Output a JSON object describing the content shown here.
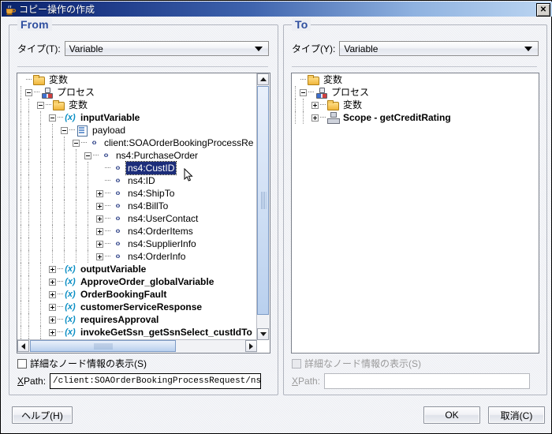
{
  "window": {
    "title": "コピー操作の作成",
    "icon": "java-coffee-cup-icon",
    "close_label": "✕"
  },
  "from_panel": {
    "title": "From",
    "type_label": "タイプ(T):",
    "type_value": "Variable",
    "type_icon": "chevron-down-icon",
    "checkbox_label": "詳細なノード情報の表示(S)",
    "checkbox_checked": false,
    "xpath_label": "XPath:",
    "xpath_value": "/client:SOAOrderBookingProcessRequest/ns",
    "tree": [
      {
        "depth": 0,
        "expander": "none",
        "icon": "folder-icon",
        "label": "変数",
        "bold": false,
        "selected": false
      },
      {
        "depth": 1,
        "expander": "minus",
        "icon": "process-icon",
        "label": "プロセス",
        "bold": false,
        "selected": false
      },
      {
        "depth": 2,
        "expander": "minus",
        "icon": "folder-icon",
        "label": "変数",
        "bold": false,
        "selected": false
      },
      {
        "depth": 3,
        "expander": "minus",
        "icon": "variable-icon",
        "label": "inputVariable",
        "bold": true,
        "selected": false
      },
      {
        "depth": 4,
        "expander": "minus",
        "icon": "payload-icon",
        "label": "payload",
        "bold": false,
        "selected": false
      },
      {
        "depth": 5,
        "expander": "minus",
        "icon": "element-icon",
        "label": "client:SOAOrderBookingProcessRe",
        "bold": false,
        "selected": false
      },
      {
        "depth": 6,
        "expander": "minus",
        "icon": "element-icon",
        "label": "ns4:PurchaseOrder",
        "bold": false,
        "selected": false
      },
      {
        "depth": 7,
        "expander": "none",
        "icon": "element-icon",
        "label": "ns4:CustID",
        "bold": false,
        "selected": true
      },
      {
        "depth": 7,
        "expander": "none",
        "icon": "element-icon",
        "label": "ns4:ID",
        "bold": false,
        "selected": false
      },
      {
        "depth": 7,
        "expander": "plus",
        "icon": "element-icon",
        "label": "ns4:ShipTo",
        "bold": false,
        "selected": false
      },
      {
        "depth": 7,
        "expander": "plus",
        "icon": "element-icon",
        "label": "ns4:BillTo",
        "bold": false,
        "selected": false
      },
      {
        "depth": 7,
        "expander": "plus",
        "icon": "element-icon",
        "label": "ns4:UserContact",
        "bold": false,
        "selected": false
      },
      {
        "depth": 7,
        "expander": "plus",
        "icon": "element-icon",
        "label": "ns4:OrderItems",
        "bold": false,
        "selected": false
      },
      {
        "depth": 7,
        "expander": "plus",
        "icon": "element-icon",
        "label": "ns4:SupplierInfo",
        "bold": false,
        "selected": false
      },
      {
        "depth": 7,
        "expander": "plus",
        "icon": "element-icon",
        "label": "ns4:OrderInfo",
        "bold": false,
        "selected": false
      },
      {
        "depth": 3,
        "expander": "plus",
        "icon": "variable-icon",
        "label": "outputVariable",
        "bold": true,
        "selected": false
      },
      {
        "depth": 3,
        "expander": "plus",
        "icon": "variable-icon",
        "label": "ApproveOrder_globalVariable",
        "bold": true,
        "selected": false
      },
      {
        "depth": 3,
        "expander": "plus",
        "icon": "variable-icon",
        "label": "OrderBookingFault",
        "bold": true,
        "selected": false
      },
      {
        "depth": 3,
        "expander": "plus",
        "icon": "variable-icon",
        "label": "customerServiceResponse",
        "bold": true,
        "selected": false
      },
      {
        "depth": 3,
        "expander": "plus",
        "icon": "variable-icon",
        "label": "requiresApproval",
        "bold": true,
        "selected": false
      },
      {
        "depth": 3,
        "expander": "plus",
        "icon": "variable-icon",
        "label": "invokeGetSsn_getSsnSelect_custIdTo",
        "bold": true,
        "selected": false
      },
      {
        "depth": 3,
        "expander": "plus",
        "icon": "variable-icon",
        "label": "invokeGetSsn_getSsnSelect_custIdTo",
        "bold": true,
        "selected": false
      }
    ]
  },
  "to_panel": {
    "title": "To",
    "type_label": "タイプ(Y):",
    "type_value": "Variable",
    "type_icon": "chevron-down-icon",
    "checkbox_label": "詳細なノード情報の表示(S)",
    "checkbox_checked": false,
    "checkbox_disabled": true,
    "xpath_label": "XPath:",
    "xpath_value": "",
    "xpath_disabled": true,
    "tree": [
      {
        "depth": 0,
        "expander": "none",
        "icon": "folder-icon",
        "label": "変数",
        "bold": false,
        "selected": false
      },
      {
        "depth": 1,
        "expander": "minus",
        "icon": "process-icon",
        "label": "プロセス",
        "bold": false,
        "selected": false
      },
      {
        "depth": 2,
        "expander": "plus",
        "icon": "folder-icon",
        "label": "変数",
        "bold": false,
        "selected": false
      },
      {
        "depth": 2,
        "expander": "plus",
        "icon": "scope-icon",
        "label": "Scope - getCreditRating",
        "bold": true,
        "selected": false
      }
    ]
  },
  "buttons": {
    "help": "ヘルプ(H)",
    "ok": "OK",
    "cancel": "取消(C)"
  },
  "colors": {
    "title_bar_start": "#0a246a",
    "title_bar_end": "#bcd6f2",
    "group_title": "#2f4f9f",
    "selection": "#1c2d7a",
    "dialog_bg": "#eceef3"
  }
}
